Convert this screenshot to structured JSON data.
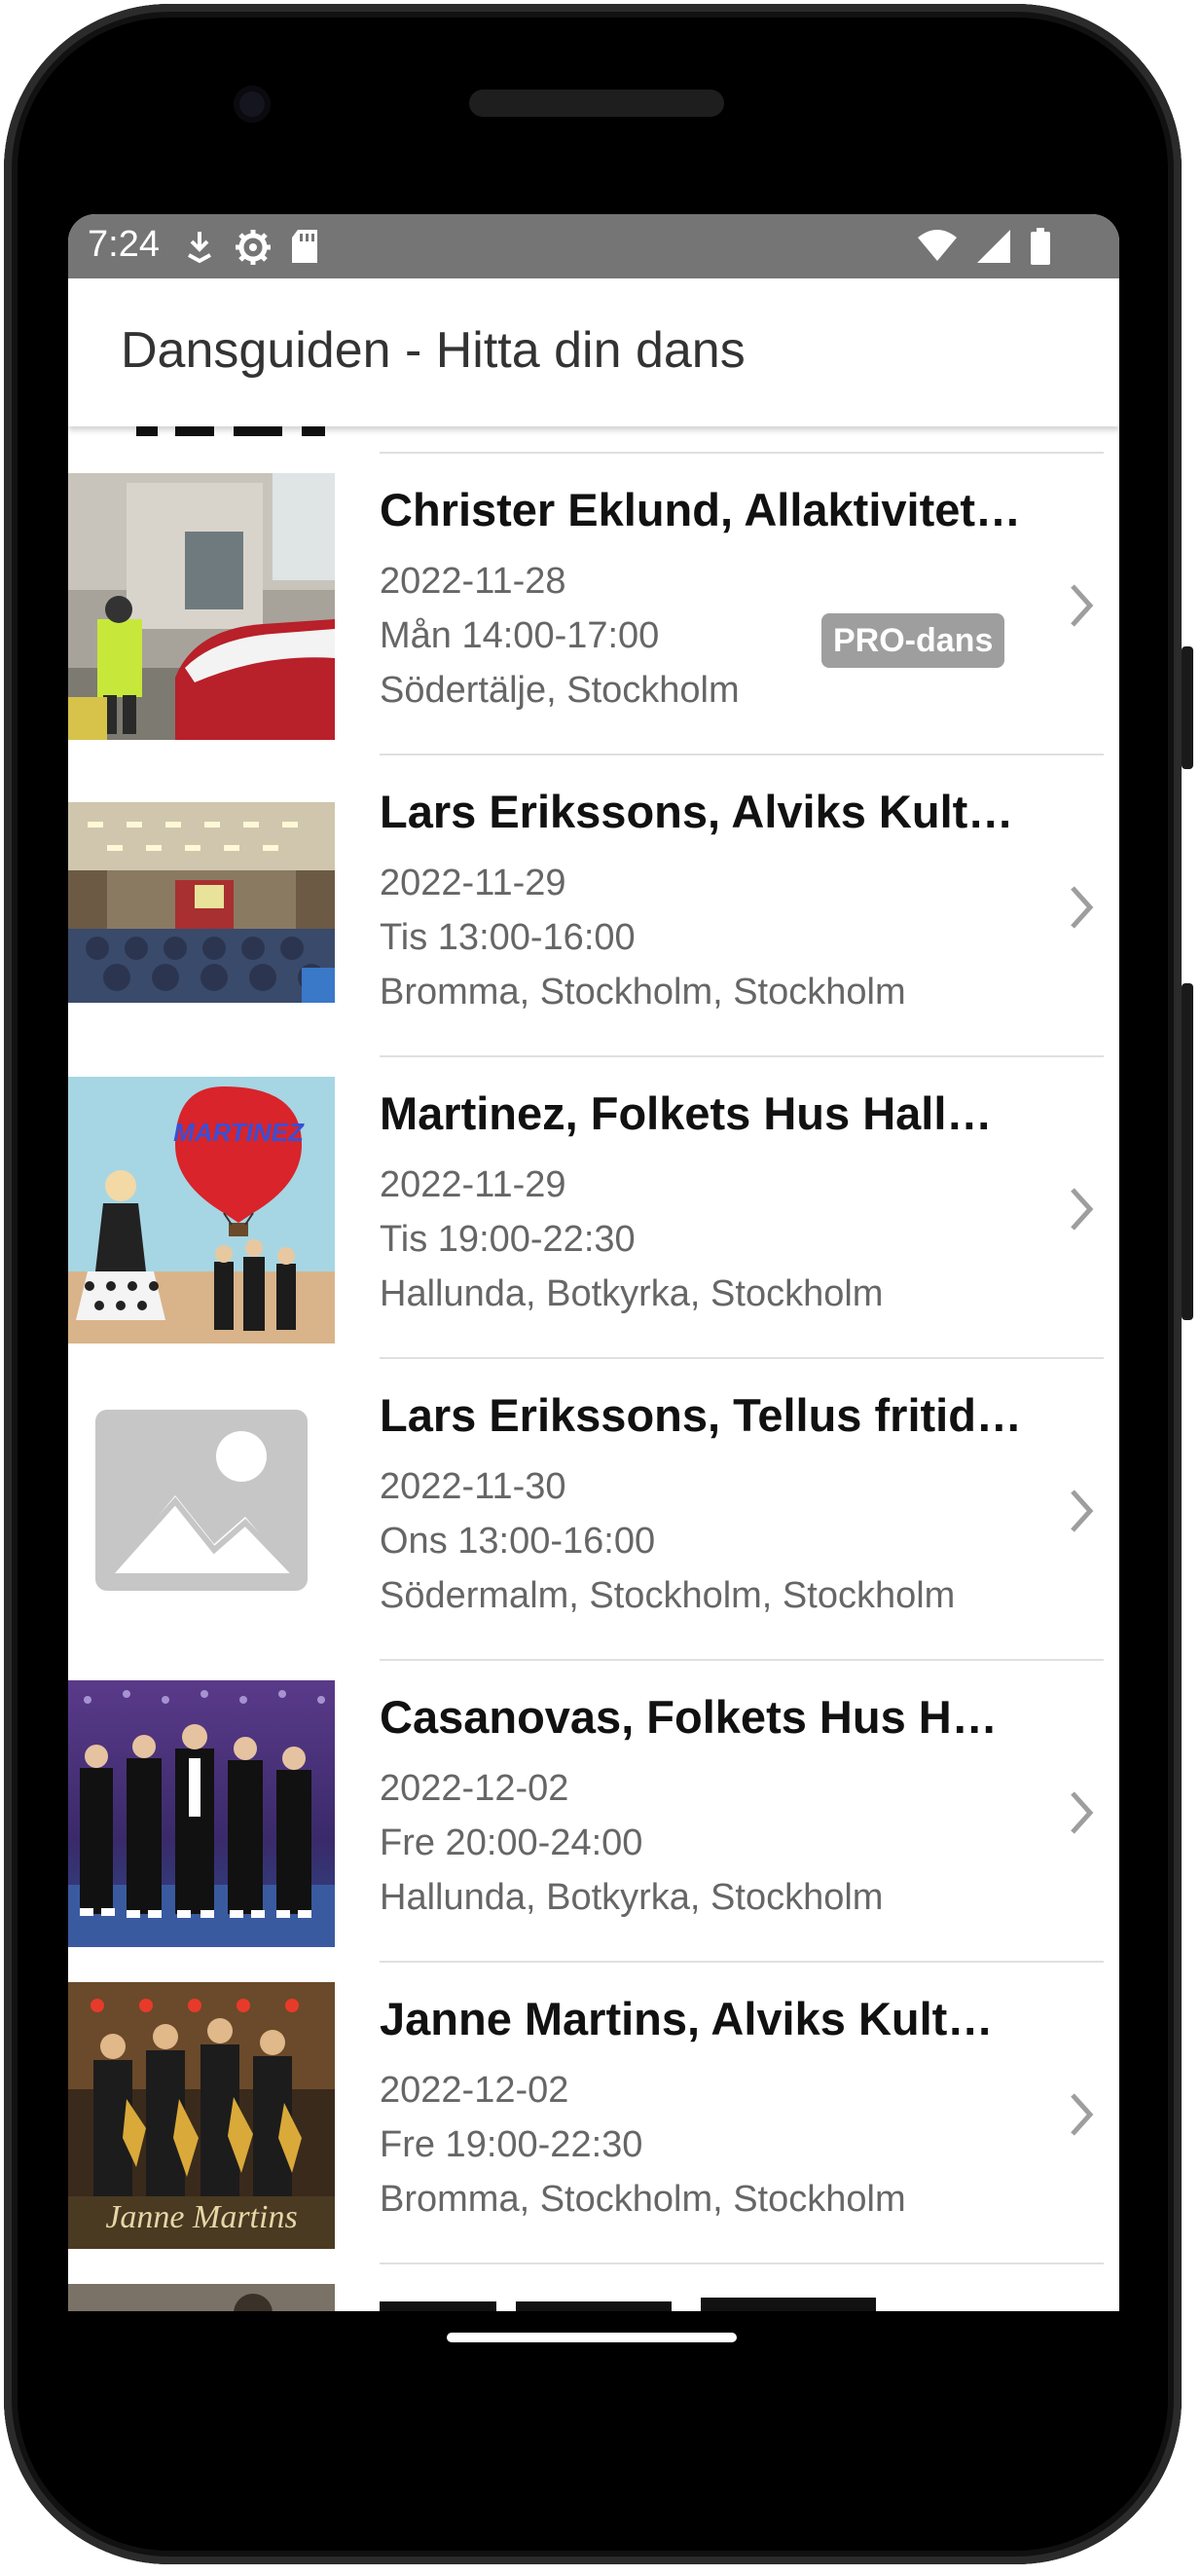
{
  "status_bar": {
    "time": "7:24",
    "left_icons": [
      "download-icon",
      "settings-icon",
      "sd-card-icon"
    ],
    "right_icons": [
      "wifi-icon",
      "signal-icon",
      "battery-icon"
    ],
    "background": "#757575"
  },
  "app_bar": {
    "title": "Dansguiden - Hitta din dans"
  },
  "list": {
    "items": [
      {
        "title": "Christer Eklund, Allaktivitet…",
        "date": "2022-11-28",
        "time": "Mån 14:00-17:00",
        "place": "Södertälje, Stockholm",
        "badge": "PRO-dans",
        "thumb": "photo-worker-car"
      },
      {
        "title": "Lars Erikssons, Alviks Kult…",
        "date": "2022-11-29",
        "time": "Tis 13:00-16:00",
        "place": "Bromma, Stockholm, Stockholm",
        "badge": "",
        "thumb": "photo-hall-audience"
      },
      {
        "title": "Martinez, Folkets Hus Hall…",
        "date": "2022-11-29",
        "time": "Tis 19:00-22:30",
        "place": "Hallunda, Botkyrka, Stockholm",
        "badge": "",
        "thumb": "photo-balloon-band",
        "thumb_text": "MARTINEZ"
      },
      {
        "title": "Lars Erikssons, Tellus fritid…",
        "date": "2022-11-30",
        "time": "Ons 13:00-16:00",
        "place": "Södermalm, Stockholm, Stockholm",
        "badge": "",
        "thumb": "image-placeholder-icon"
      },
      {
        "title": "Casanovas, Folkets Hus Ha…",
        "date": "2022-12-02",
        "time": "Fre 20:00-24:00",
        "place": "Hallunda, Botkyrka, Stockholm",
        "badge": "",
        "thumb": "photo-band-stage"
      },
      {
        "title": "Janne Martins, Alviks Kult…",
        "date": "2022-12-02",
        "time": "Fre 19:00-22:30",
        "place": "Bromma, Stockholm, Stockholm",
        "badge": "",
        "thumb": "photo-band-saxophones",
        "thumb_text": "Janne Martins"
      }
    ]
  }
}
